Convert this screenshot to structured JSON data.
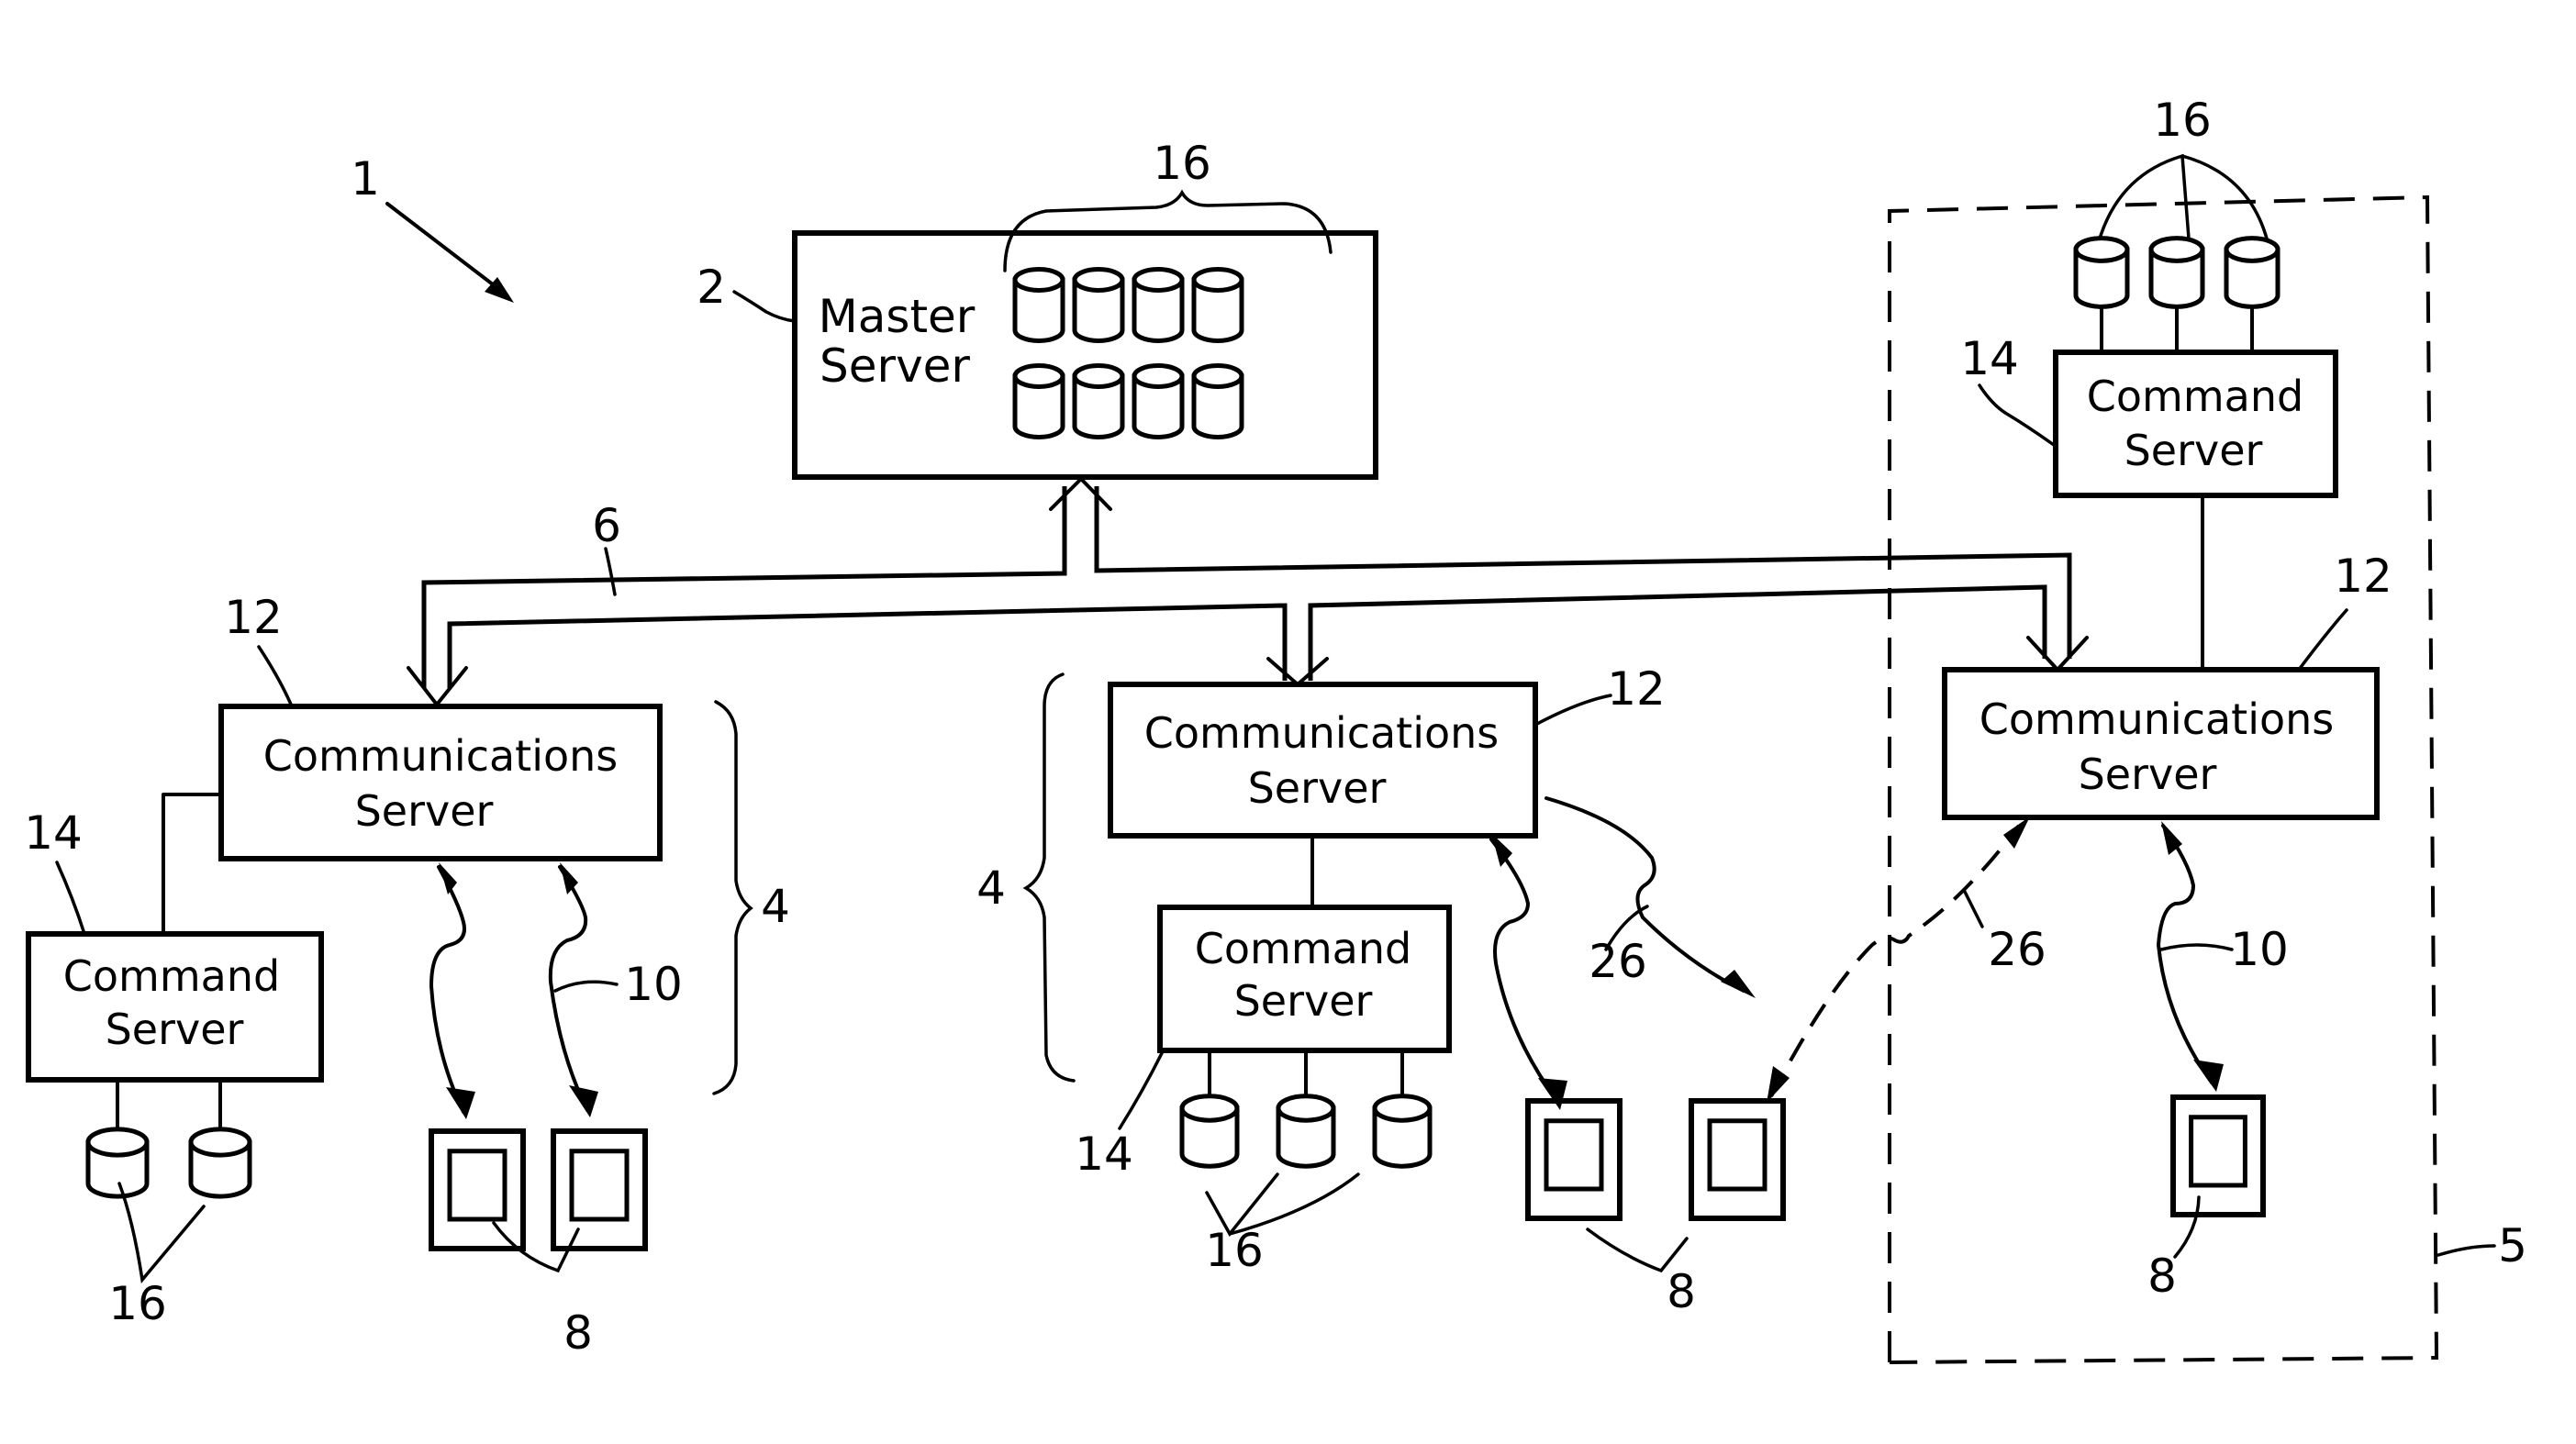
{
  "figure": {
    "reference_system": "1",
    "master_server": {
      "ref": "2",
      "label_line1": "Master",
      "label_line2": "Server",
      "db_ref": "16",
      "db_count": 8
    },
    "bus": {
      "ref": "6"
    },
    "sites": [
      {
        "id": "left",
        "site_ref": "4",
        "comm_server": {
          "ref": "12",
          "label_line1": "Communications",
          "label_line2": "Server"
        },
        "command_server": {
          "ref": "14",
          "label_line1": "Command",
          "label_line2": "Server"
        },
        "db_ref": "16",
        "db_count": 2,
        "devices_ref": "8",
        "device_count": 2,
        "link_ref": "10"
      },
      {
        "id": "middle",
        "site_ref": "4",
        "comm_server": {
          "ref": "12",
          "label_line1": "Communications",
          "label_line2": "Server"
        },
        "command_server": {
          "ref": "14",
          "label_line1": "Command",
          "label_line2": "Server"
        },
        "db_ref": "16",
        "db_count": 3,
        "devices_ref": "8",
        "device_count": 2,
        "link_ref": "26"
      },
      {
        "id": "right",
        "site_ref": "5",
        "comm_server": {
          "ref": "12",
          "label_line1": "Communications",
          "label_line2": "Server"
        },
        "command_server": {
          "ref": "14",
          "label_line1": "Command",
          "label_line2": "Server"
        },
        "db_ref": "16",
        "db_count": 3,
        "devices_ref": "8",
        "device_count": 1,
        "link_ref": "10",
        "roaming_link_ref": "26"
      }
    ]
  }
}
